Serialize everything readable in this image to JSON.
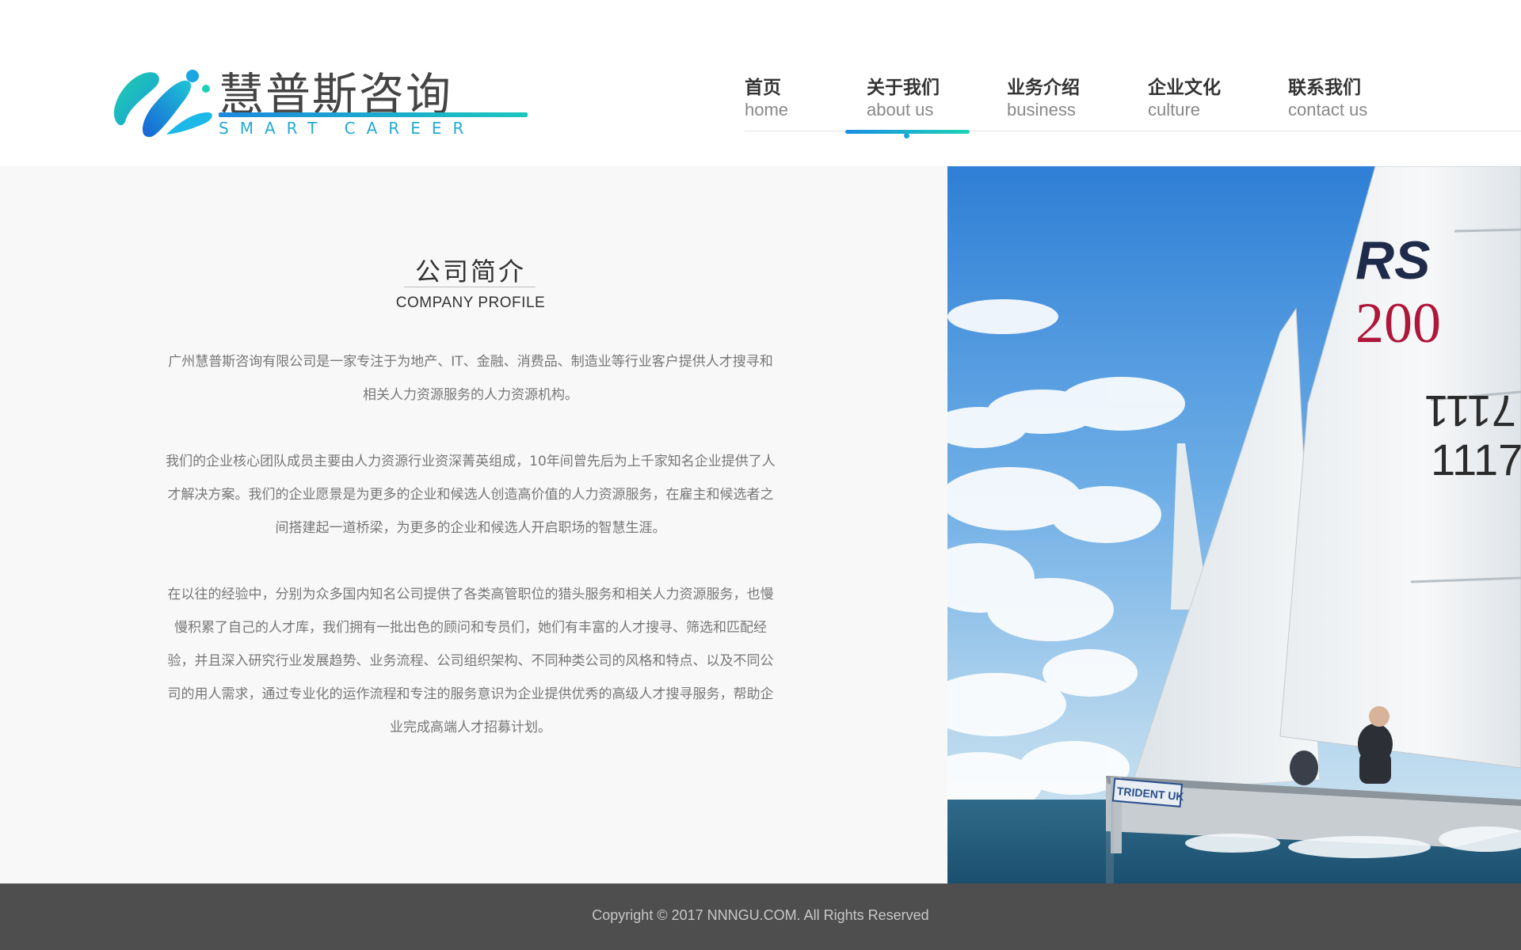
{
  "brand": {
    "name_cn": "慧普斯咨询",
    "name_en": "SMART CAREER",
    "colors": {
      "primary_blue": "#1a8ee4",
      "primary_teal": "#1fd3b6"
    }
  },
  "nav": {
    "items": [
      {
        "cn": "首页",
        "en": "home"
      },
      {
        "cn": "关于我们",
        "en": "about us"
      },
      {
        "cn": "业务介绍",
        "en": "business"
      },
      {
        "cn": "企业文化",
        "en": "culture"
      },
      {
        "cn": "联系我们",
        "en": "contact us"
      }
    ],
    "active": "about us"
  },
  "about": {
    "title": "公司简介",
    "subtitle": "COMPANY PROFILE",
    "paragraphs": [
      "广州慧普斯咨询有限公司是一家专注于为地产、IT、金融、消费品、制造业等行业客户提供人才搜寻和相关人力资源服务的人力资源机构。",
      "我们的企业核心团队成员主要由人力资源行业资深菁英组成，10年间曾先后为上千家知名企业提供了人才解决方案。我们的企业愿景是为更多的企业和候选人创造高价值的人力资源服务，在雇主和候选者之间搭建起一道桥梁，为更多的企业和候选人开启职场的智慧生涯。",
      "在以往的经验中，分别为众多国内知名公司提供了各类高管职位的猎头服务和相关人力资源服务，也慢慢积累了自己的人才库，我们拥有一批出色的顾问和专员们，她们有丰富的人才搜寻、筛选和匹配经验，并且深入研究行业发展趋势、业务流程、公司组织架构、不同种类公司的风格和特点、以及不同公司的用人需求，通过专业化的运作流程和专注的服务意识为企业提供优秀的高级人才搜寻服务，帮助企业完成高端人才招募计划。"
    ]
  },
  "photo": {
    "sail_letters": "RS",
    "sail_number_model": "200",
    "sail_number_a": "7111",
    "sail_number_b": "1117",
    "hull_text": "TRIDENT UK"
  },
  "footer": {
    "copyright": "Copyright © 2017 NNNGU.COM. All Rights Reserved"
  }
}
